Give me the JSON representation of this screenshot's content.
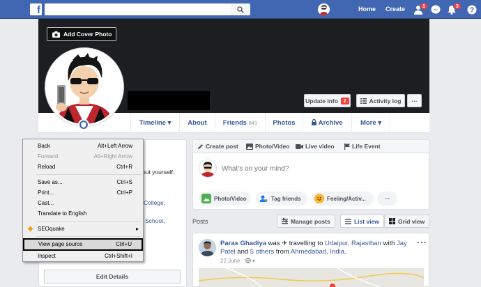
{
  "topbar": {
    "search_placeholder": "",
    "home": "Home",
    "create": "Create",
    "friend_requests_badge": "1",
    "notifications_badge": "3"
  },
  "cover": {
    "add_cover_photo": "Add Cover Photo",
    "update_info": "Update Info",
    "update_info_badge": "2",
    "activity_log": "Activity log",
    "more_dots": "···"
  },
  "nav": {
    "timeline": "Timeline",
    "about": "About",
    "friends": "Friends",
    "friends_count": "841",
    "photos": "Photos",
    "archive": "Archive",
    "more": "More"
  },
  "intro": {
    "partial_text": "out yourself.",
    "link1": "College,",
    "link2": "School,",
    "edit_details": "Edit Details"
  },
  "context_menu": {
    "items": [
      {
        "label": "Back",
        "shortcut": "Alt+Left Arrow",
        "disabled": false
      },
      {
        "label": "Forward",
        "shortcut": "Alt+Right Arrow",
        "disabled": true
      },
      {
        "label": "Reload",
        "shortcut": "Ctrl+R",
        "disabled": false
      },
      {
        "label": "Save as...",
        "shortcut": "Ctrl+S",
        "disabled": false
      },
      {
        "label": "Print...",
        "shortcut": "Ctrl+P",
        "disabled": false
      },
      {
        "label": "Cast...",
        "shortcut": "",
        "disabled": false
      },
      {
        "label": "Translate to English",
        "shortcut": "",
        "disabled": false
      },
      {
        "label": "SEOquake",
        "shortcut": "",
        "disabled": false
      },
      {
        "label": "View page source",
        "shortcut": "Ctrl+U",
        "disabled": false
      },
      {
        "label": "Inspect",
        "shortcut": "Ctrl+Shift+I",
        "disabled": false
      }
    ],
    "highlighted": "View page source"
  },
  "composer": {
    "tabs": [
      "Create post",
      "Photo/Video",
      "Live video",
      "Life Event"
    ],
    "placeholder": "What's on your mind?",
    "pills": [
      "Photo/Video",
      "Tag friends",
      "Feeling/Activ..."
    ],
    "more_dots": "···"
  },
  "posts_header": {
    "title": "Posts",
    "manage_posts": "Manage posts",
    "list_view": "List view",
    "grid_view": "Grid view"
  },
  "post": {
    "author": "Paras Ghadiya",
    "verb": "was ✈ travelling to",
    "place": "Udaipur, Rajasthan",
    "with_word": "with",
    "friend": "Jay Patel",
    "and_word": "and",
    "others": "5 others",
    "from_word": "from",
    "from_place": "Ahmedabad, India",
    "period": ".",
    "date": "22 June ·",
    "more": "···"
  },
  "colors": {
    "brand": "#4267b2",
    "link": "#365899",
    "badge": "#fa3e3e"
  }
}
